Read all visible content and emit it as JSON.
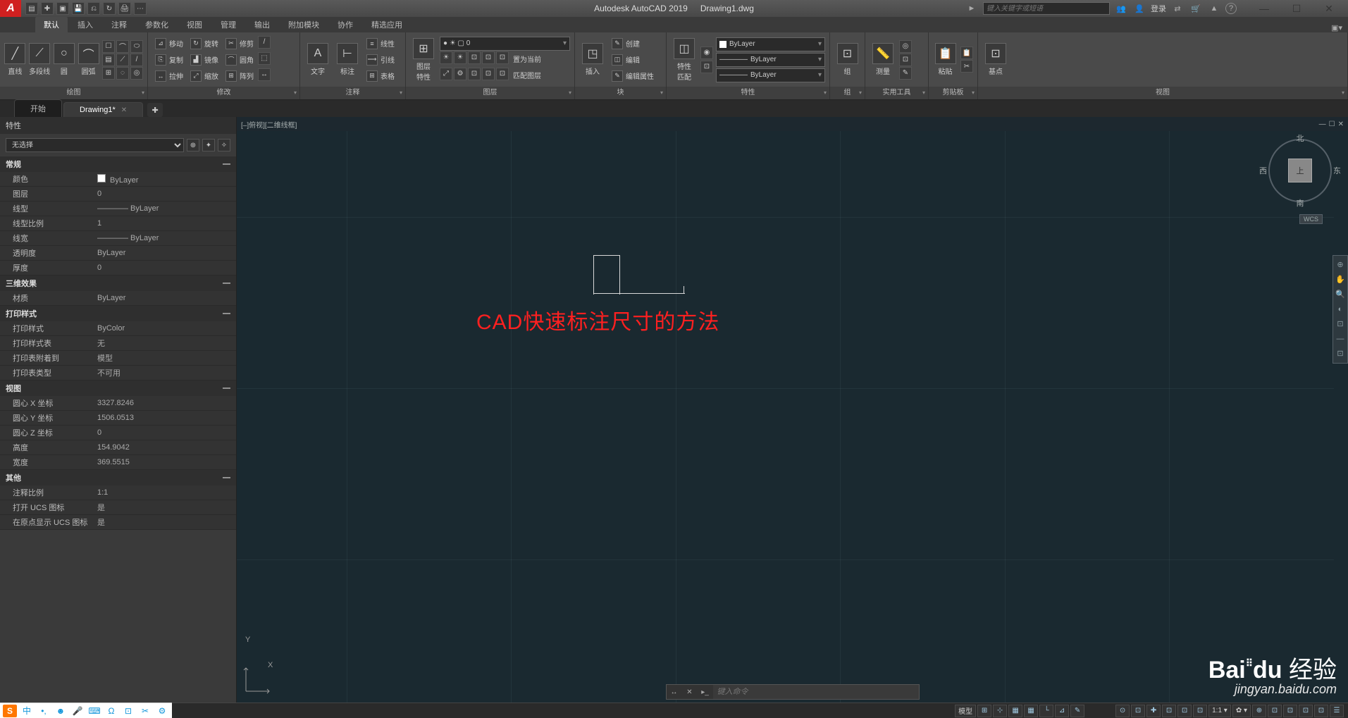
{
  "app": {
    "title": "Autodesk AutoCAD 2019",
    "doc": "Drawing1.dwg",
    "logo": "A"
  },
  "qat": [
    "▤",
    "✚",
    "▣",
    "💾",
    "⎌",
    "↻",
    "🖨",
    "⋯"
  ],
  "search": {
    "placeholder": "键入关键字或短语",
    "icon": "►"
  },
  "title_right": {
    "infocenter": "👥",
    "login": "登录",
    "exchange": "⇄",
    "cart": "🛒",
    "cloud": "▲",
    "help": "?"
  },
  "win": {
    "min": "—",
    "max": "☐",
    "close": "✕"
  },
  "tabs": [
    "默认",
    "插入",
    "注释",
    "参数化",
    "视图",
    "管理",
    "输出",
    "附加模块",
    "协作",
    "精选应用"
  ],
  "ribbon": {
    "draw": {
      "title": "绘图",
      "line": "直线",
      "pline": "多段线",
      "circle": "圆",
      "arc": "圆弧",
      "extras": [
        "☐",
        "⌒",
        "⬭",
        "▤",
        "⟋",
        "/",
        "⊞",
        "◌",
        "◎"
      ]
    },
    "modify": {
      "title": "修改",
      "move": "移动",
      "rotate": "旋转",
      "trim": "修剪",
      "copy": "复制",
      "mirror": "镜像",
      "fillet": "圆角",
      "stretch": "拉伸",
      "scale": "缩放",
      "array": "阵列",
      "icons": [
        "⊿",
        "↻",
        "✂",
        "⎘",
        "▟",
        "⌒",
        "↔",
        "⤢",
        "⊞",
        "⬚",
        "↔",
        "/"
      ]
    },
    "annot": {
      "title": "注释",
      "text": "文字",
      "dim": "标注",
      "leader": "引线",
      "linetype": "线性",
      "table": "表格",
      "icons": [
        "A",
        "⊢",
        "⟶",
        "≡",
        "⊞"
      ]
    },
    "layer": {
      "title": "图层",
      "prop": "图层\n特性",
      "current": "置为当前",
      "match": "匹配图层",
      "sel": "● ☀ ▢ 0",
      "row": [
        "☀",
        "☀",
        "⊡",
        "⊡",
        "⊡",
        "⤢",
        "⚙",
        "⊡",
        "⊡"
      ]
    },
    "block": {
      "title": "块",
      "insert": "插入",
      "create": "创建",
      "edit": "编辑",
      "editattr": "编辑属性",
      "icons": [
        "◳",
        "✎",
        "◫",
        "✎"
      ]
    },
    "props": {
      "title": "特性",
      "match": "特性\n匹配",
      "bylayer": "ByLayer",
      "icons": [
        "◉",
        "⊡"
      ]
    },
    "group": {
      "title": "组",
      "group": "组",
      "icon": "⊡"
    },
    "util": {
      "title": "实用工具",
      "measure": "测量",
      "icons": [
        "📏",
        "◎",
        "⊡",
        "✎"
      ]
    },
    "clip": {
      "title": "剪贴板",
      "paste": "粘贴",
      "icons": [
        "📋",
        "📋",
        "✂"
      ]
    },
    "view": {
      "title": "视图",
      "base": "基点",
      "icon": "⊡"
    }
  },
  "doc_tabs": {
    "start": "开始",
    "drawing": "Drawing1*",
    "add": "✚"
  },
  "palette": {
    "title": "特性",
    "select": "无选择",
    "collapse": "—",
    "sections": [
      {
        "h": "常规",
        "rows": [
          {
            "k": "颜色",
            "v": "ByLayer",
            "sw": true
          },
          {
            "k": "图层",
            "v": "0"
          },
          {
            "k": "线型",
            "v": "———— ByLayer"
          },
          {
            "k": "线型比例",
            "v": "1"
          },
          {
            "k": "线宽",
            "v": "———— ByLayer"
          },
          {
            "k": "透明度",
            "v": "ByLayer"
          },
          {
            "k": "厚度",
            "v": "0"
          }
        ]
      },
      {
        "h": "三维效果",
        "rows": [
          {
            "k": "材质",
            "v": "ByLayer"
          }
        ]
      },
      {
        "h": "打印样式",
        "rows": [
          {
            "k": "打印样式",
            "v": "ByColor"
          },
          {
            "k": "打印样式表",
            "v": "无"
          },
          {
            "k": "打印表附着到",
            "v": "模型"
          },
          {
            "k": "打印表类型",
            "v": "不可用"
          }
        ]
      },
      {
        "h": "视图",
        "rows": [
          {
            "k": "圆心 X 坐标",
            "v": "3327.8246"
          },
          {
            "k": "圆心 Y 坐标",
            "v": "1506.0513"
          },
          {
            "k": "圆心 Z 坐标",
            "v": "0"
          },
          {
            "k": "高度",
            "v": "154.9042"
          },
          {
            "k": "宽度",
            "v": "369.5515"
          }
        ]
      },
      {
        "h": "其他",
        "rows": [
          {
            "k": "注释比例",
            "v": "1:1"
          },
          {
            "k": "打开 UCS 图标",
            "v": "是"
          },
          {
            "k": "在原点显示 UCS 图标",
            "v": "是"
          }
        ]
      }
    ],
    "qicons": [
      "⊕",
      "✦",
      "✧"
    ]
  },
  "canvas": {
    "viewlabel": "[–]俯视][二维线框]",
    "overlay": "CAD快速标注尺寸的方法",
    "viewcube": {
      "top": "上",
      "n": "北",
      "s": "南",
      "e": "东",
      "w": "西"
    },
    "wcs": "WCS",
    "ucs": {
      "x": "X",
      "y": "Y"
    },
    "nav": [
      "⊕",
      "✋",
      "🔍",
      "◐",
      "⊡",
      "—",
      "⊡"
    ]
  },
  "cmd": {
    "placeholder": "键入命令",
    "icons": [
      "↔",
      "✕",
      "▸_"
    ]
  },
  "status": {
    "left": [
      "模型",
      "⊞",
      "⊹",
      "▦",
      "▦",
      "└",
      "⊿",
      "✎"
    ],
    "right": [
      "⊙",
      "⊡",
      "✚",
      "⊡",
      "⊡",
      "⊡",
      "1:1 ▾",
      "✿ ▾",
      "⊕",
      "⊡",
      "⊡",
      "⊡",
      "⊡",
      "☰"
    ]
  },
  "watermark": {
    "brand": "Baidu 经验",
    "paw": "⠿",
    "url": "jingyan.baidu.com"
  },
  "ime": {
    "logo": "S",
    "items": [
      "中",
      "•,",
      "☻",
      "🎤",
      "⌨",
      "Ω",
      "⊡",
      "✂",
      "⚙"
    ]
  }
}
